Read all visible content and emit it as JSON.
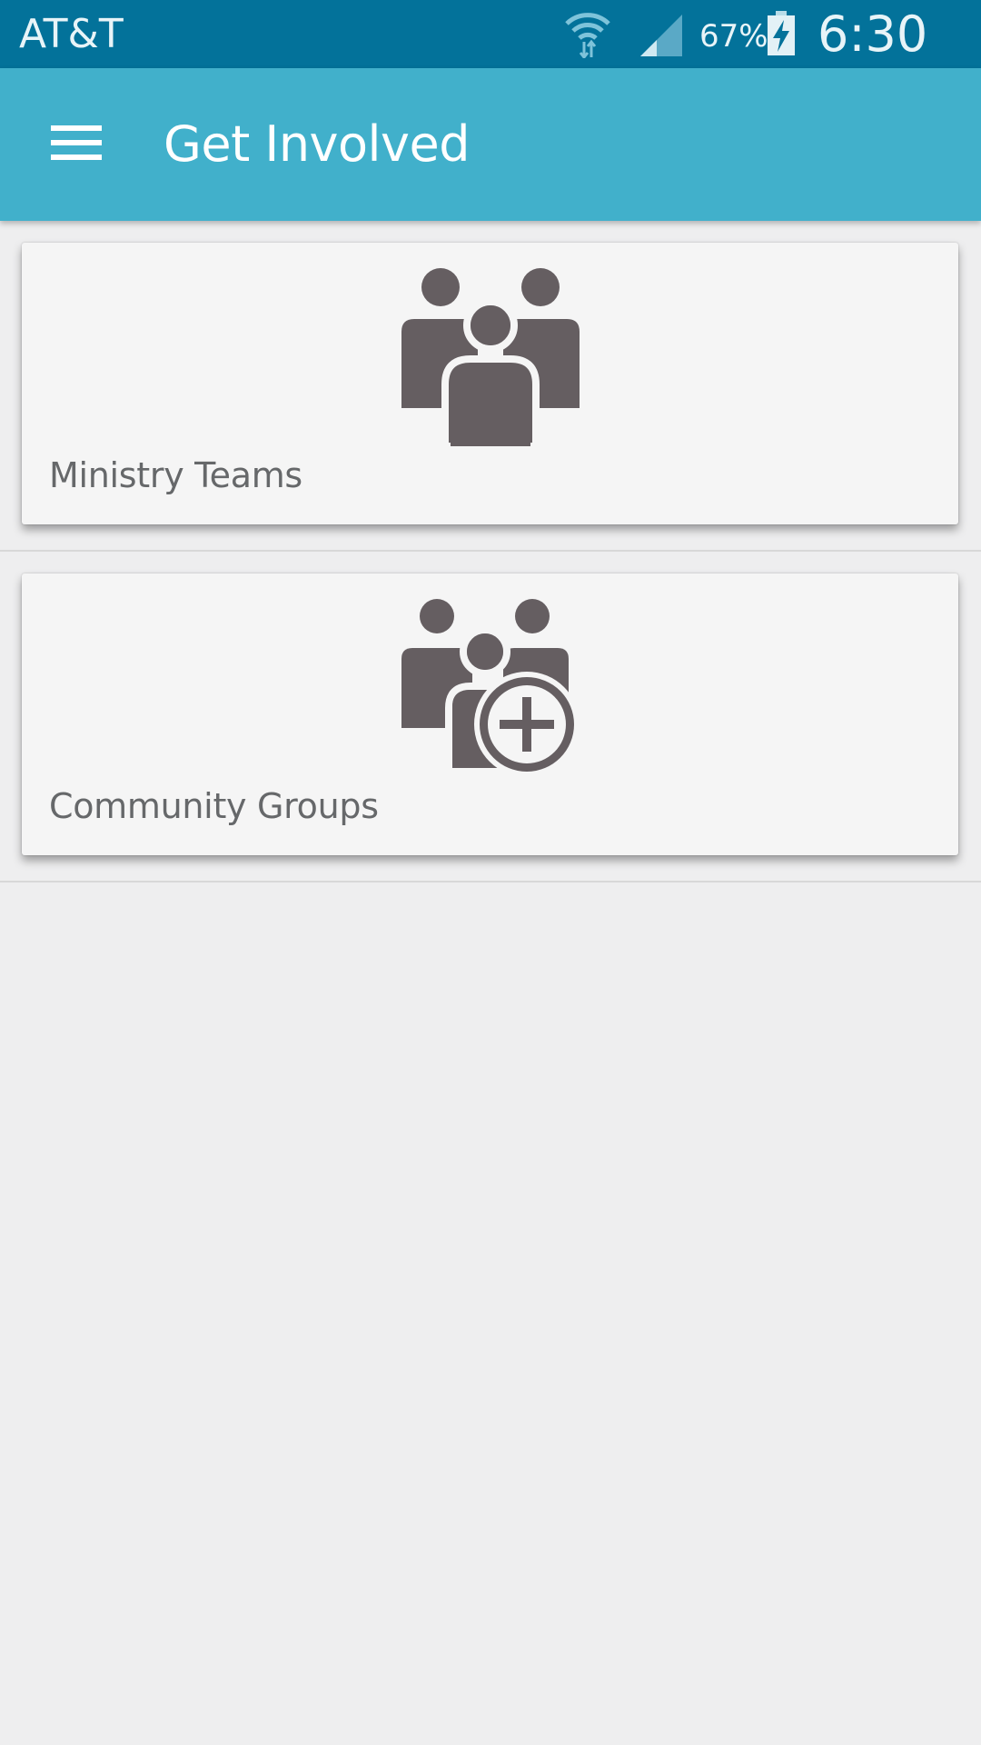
{
  "status_bar": {
    "carrier": "AT&T",
    "battery_percent": "67%",
    "time": "6:30 PM",
    "icons": [
      "wifi-icon",
      "signal-icon",
      "battery-charging-icon"
    ]
  },
  "app_bar": {
    "title": "Get Involved",
    "menu_icon": "hamburger-menu-icon",
    "color": "#41b0cb"
  },
  "items": [
    {
      "label": "Ministry Teams",
      "icon": "group-people-icon"
    },
    {
      "label": "Community Groups",
      "icon": "group-add-icon"
    }
  ],
  "colors": {
    "status_bar": "#03729a",
    "app_bar": "#41b0cb",
    "background": "#eeeeef",
    "card": "#f5f5f5",
    "icon": "#655e61"
  }
}
